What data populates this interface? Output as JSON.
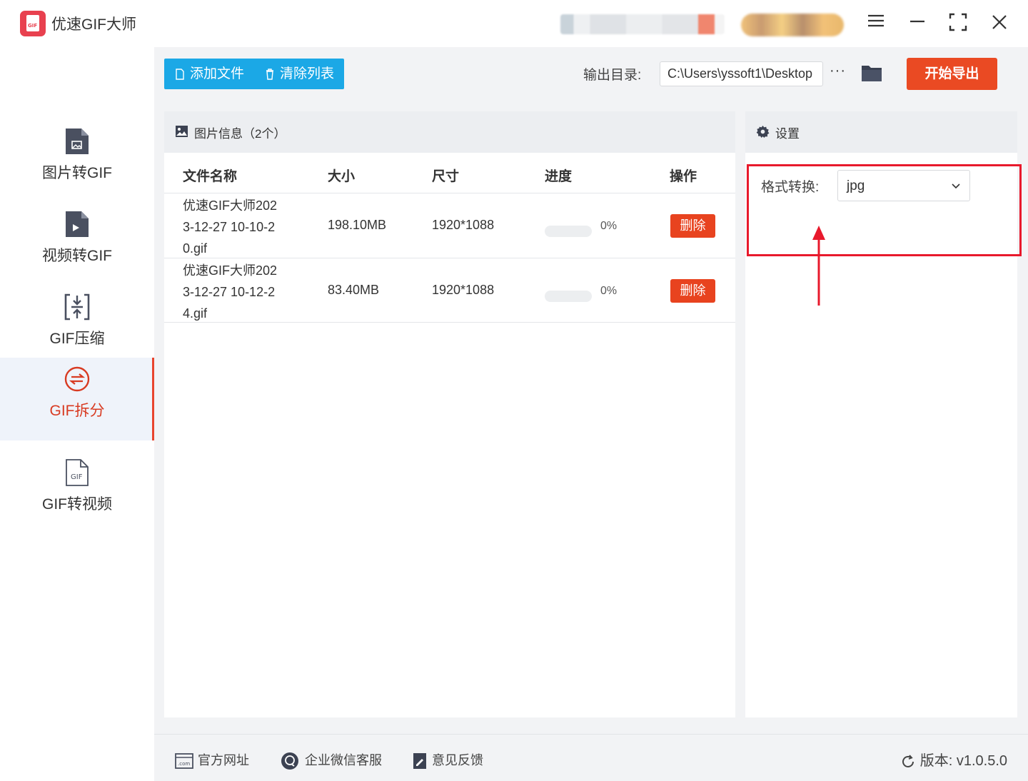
{
  "app": {
    "title": "优速GIF大师",
    "logo_text": "GIF",
    "accent_color": "#e8442d",
    "primary_color": "#1ba8e6"
  },
  "sidebar": {
    "items": [
      {
        "label": "图片转GIF",
        "icon": "image-file-icon",
        "active": false
      },
      {
        "label": "视频转GIF",
        "icon": "video-file-icon",
        "active": false
      },
      {
        "label": "GIF压缩",
        "icon": "compress-icon",
        "active": false
      },
      {
        "label": "GIF拆分",
        "icon": "split-icon",
        "active": true
      },
      {
        "label": "GIF转视频",
        "icon": "gif-file-icon",
        "active": false
      }
    ]
  },
  "toolbar": {
    "add_file_label": "添加文件",
    "clear_list_label": "清除列表",
    "output_dir_label": "输出目录:",
    "output_dir_value": "C:\\Users\\yssoft1\\Desktop",
    "more_label": "···",
    "export_label": "开始导出"
  },
  "file_panel": {
    "title": "图片信息（2个）",
    "columns": [
      "文件名称",
      "大小",
      "尺寸",
      "进度",
      "操作"
    ],
    "rows": [
      {
        "name_lines": [
          "优速GIF大师202",
          "3-12-27 10-10-2",
          "0.gif"
        ],
        "size": "198.10MB",
        "dimensions": "1920*1088",
        "progress": 0,
        "progress_text": "0%",
        "action": "删除"
      },
      {
        "name_lines": [
          "优速GIF大师202",
          "3-12-27 10-12-2",
          "4.gif"
        ],
        "size": "83.40MB",
        "dimensions": "1920*1088",
        "progress": 0,
        "progress_text": "0%",
        "action": "删除"
      }
    ]
  },
  "settings": {
    "title": "设置",
    "format_label": "格式转换:",
    "format_value": "jpg"
  },
  "footer": {
    "website_label": "官方网址",
    "wechat_label": "企业微信客服",
    "feedback_label": "意见反馈",
    "version_label": "版本: v1.0.5.0"
  }
}
